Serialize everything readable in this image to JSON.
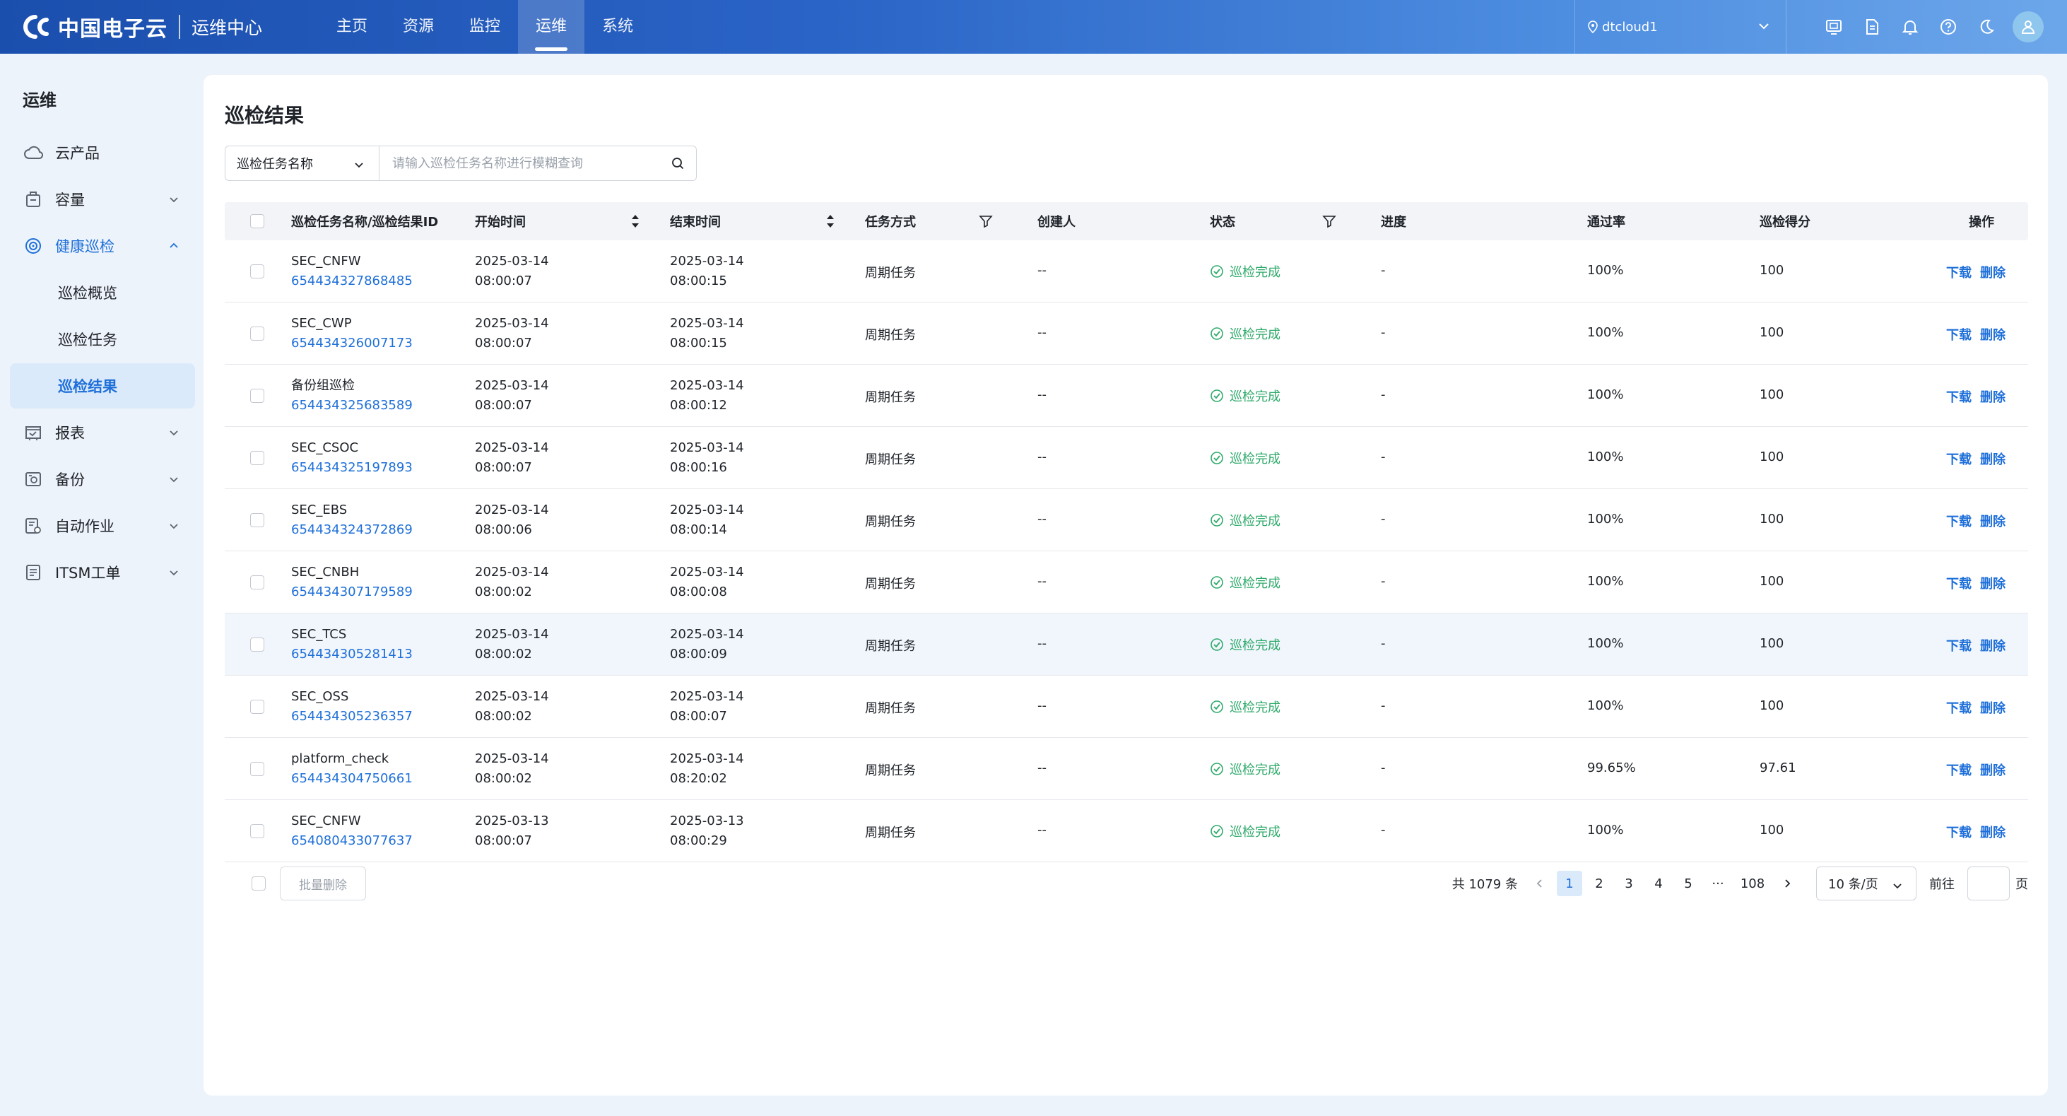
{
  "app": {
    "brand": "中国电子云",
    "subtitle": "运维中心"
  },
  "nav": {
    "items": [
      "主页",
      "资源",
      "监控",
      "运维",
      "系统"
    ],
    "active_index": 3
  },
  "region": {
    "label": "dtcloud1"
  },
  "top_icons": [
    "monitor-icon",
    "document-icon",
    "bell-icon",
    "help-icon",
    "moon-icon",
    "user-icon"
  ],
  "sidebar": {
    "title": "运维",
    "items": {
      "cloud_product": "云产品",
      "capacity": "容量",
      "health_inspection": "健康巡检",
      "sub_overview": "巡检概览",
      "sub_tasks": "巡检任务",
      "sub_results": "巡检结果",
      "reports": "报表",
      "backup": "备份",
      "auto_jobs": "自动作业",
      "itsm": "ITSM工单"
    }
  },
  "page": {
    "title": "巡检结果",
    "search_field": "巡检任务名称",
    "search_placeholder": "请输入巡检任务名称进行模糊查询"
  },
  "table": {
    "columns": {
      "name": "巡检任务名称/巡检结果ID",
      "start": "开始时间",
      "end": "结束时间",
      "mode": "任务方式",
      "creator": "创建人",
      "status": "状态",
      "progress": "进度",
      "pass_rate": "通过率",
      "score": "巡检得分",
      "ops": "操作"
    },
    "action_download": "下载",
    "action_delete": "删除",
    "rows": [
      {
        "name": "SEC_CNFW",
        "id": "654434327868485",
        "start_date": "2025-03-14",
        "start_time": "08:00:07",
        "end_date": "2025-03-14",
        "end_time": "08:00:15",
        "mode": "周期任务",
        "creator": "--",
        "status": "巡检完成",
        "progress": "-",
        "pass_rate": "100%",
        "score": "100"
      },
      {
        "name": "SEC_CWP",
        "id": "654434326007173",
        "start_date": "2025-03-14",
        "start_time": "08:00:07",
        "end_date": "2025-03-14",
        "end_time": "08:00:15",
        "mode": "周期任务",
        "creator": "--",
        "status": "巡检完成",
        "progress": "-",
        "pass_rate": "100%",
        "score": "100"
      },
      {
        "name": "备份组巡检",
        "id": "654434325683589",
        "start_date": "2025-03-14",
        "start_time": "08:00:07",
        "end_date": "2025-03-14",
        "end_time": "08:00:12",
        "mode": "周期任务",
        "creator": "--",
        "status": "巡检完成",
        "progress": "-",
        "pass_rate": "100%",
        "score": "100"
      },
      {
        "name": "SEC_CSOC",
        "id": "654434325197893",
        "start_date": "2025-03-14",
        "start_time": "08:00:07",
        "end_date": "2025-03-14",
        "end_time": "08:00:16",
        "mode": "周期任务",
        "creator": "--",
        "status": "巡检完成",
        "progress": "-",
        "pass_rate": "100%",
        "score": "100"
      },
      {
        "name": "SEC_EBS",
        "id": "654434324372869",
        "start_date": "2025-03-14",
        "start_time": "08:00:06",
        "end_date": "2025-03-14",
        "end_time": "08:00:14",
        "mode": "周期任务",
        "creator": "--",
        "status": "巡检完成",
        "progress": "-",
        "pass_rate": "100%",
        "score": "100"
      },
      {
        "name": "SEC_CNBH",
        "id": "654434307179589",
        "start_date": "2025-03-14",
        "start_time": "08:00:02",
        "end_date": "2025-03-14",
        "end_time": "08:00:08",
        "mode": "周期任务",
        "creator": "--",
        "status": "巡检完成",
        "progress": "-",
        "pass_rate": "100%",
        "score": "100"
      },
      {
        "name": "SEC_TCS",
        "id": "654434305281413",
        "start_date": "2025-03-14",
        "start_time": "08:00:02",
        "end_date": "2025-03-14",
        "end_time": "08:00:09",
        "mode": "周期任务",
        "creator": "--",
        "status": "巡检完成",
        "progress": "-",
        "pass_rate": "100%",
        "score": "100"
      },
      {
        "name": "SEC_OSS",
        "id": "654434305236357",
        "start_date": "2025-03-14",
        "start_time": "08:00:02",
        "end_date": "2025-03-14",
        "end_time": "08:00:07",
        "mode": "周期任务",
        "creator": "--",
        "status": "巡检完成",
        "progress": "-",
        "pass_rate": "100%",
        "score": "100"
      },
      {
        "name": "platform_check",
        "id": "654434304750661",
        "start_date": "2025-03-14",
        "start_time": "08:00:02",
        "end_date": "2025-03-14",
        "end_time": "08:20:02",
        "mode": "周期任务",
        "creator": "--",
        "status": "巡检完成",
        "progress": "-",
        "pass_rate": "99.65%",
        "score": "97.61"
      },
      {
        "name": "SEC_CNFW",
        "id": "654080433077637",
        "start_date": "2025-03-13",
        "start_time": "08:00:07",
        "end_date": "2025-03-13",
        "end_time": "08:00:29",
        "mode": "周期任务",
        "creator": "--",
        "status": "巡检完成",
        "progress": "-",
        "pass_rate": "100%",
        "score": "100"
      }
    ]
  },
  "footer": {
    "batch_delete": "批量删除",
    "total": "共 1079 条",
    "pages": [
      "1",
      "2",
      "3",
      "4",
      "5",
      "···",
      "108"
    ],
    "active_page": "1",
    "page_size": "10 条/页",
    "goto_label": "前往",
    "page_unit": "页"
  },
  "colors": {
    "accent": "#1e6fd9",
    "success": "#2eaa6a",
    "topbar_start": "#1b4fae",
    "topbar_end": "#6ca6ea"
  }
}
